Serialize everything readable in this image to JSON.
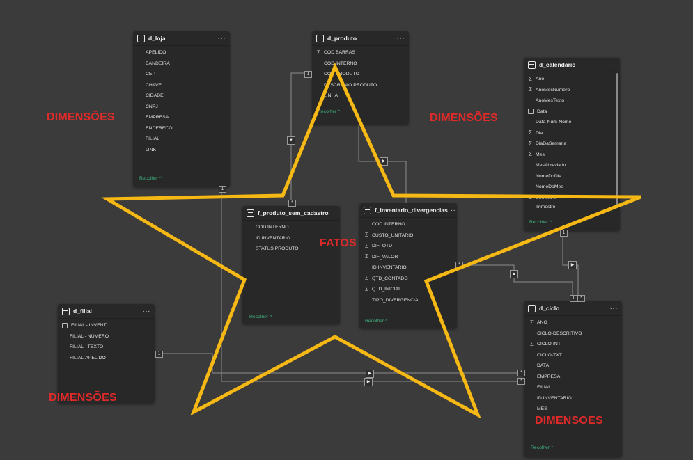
{
  "tables": {
    "d_loja": {
      "title": "d_loja",
      "menu": "···",
      "collapse": "Recolher ^",
      "fields": [
        "APELIDO",
        "BANDEIRA",
        "CEP",
        "CHAVE",
        "CIDADE",
        "CNPJ",
        "EMPRESA",
        "ENDERECO",
        "FILIAL",
        "LINK"
      ]
    },
    "d_produto": {
      "title": "d_produto",
      "menu": "···",
      "collapse": "Recolher ^",
      "fields": [
        {
          "name": "COD BARRAS",
          "icon": "sigma"
        },
        {
          "name": "COD INTERNO",
          "icon": ""
        },
        {
          "name": "COD PRODUTO",
          "icon": ""
        },
        {
          "name": "DESCRICAO PRODUTO",
          "icon": ""
        },
        {
          "name": "LINHA",
          "icon": ""
        }
      ]
    },
    "d_calendario": {
      "title": "d_calendario",
      "menu": "···",
      "collapse": "Recolher ^",
      "fields": [
        {
          "name": "Ano",
          "icon": "sigma"
        },
        {
          "name": "AnoMesNumero",
          "icon": "sigma"
        },
        {
          "name": "AnoMesTexto",
          "icon": ""
        },
        {
          "name": "Data",
          "icon": "calendar"
        },
        {
          "name": "Data-Num-Nome",
          "icon": ""
        },
        {
          "name": "Dia",
          "icon": "sigma"
        },
        {
          "name": "DiaDaSemana",
          "icon": "sigma"
        },
        {
          "name": "Mes",
          "icon": "sigma"
        },
        {
          "name": "MesAbreviado",
          "icon": ""
        },
        {
          "name": "NomeDoDia",
          "icon": ""
        },
        {
          "name": "NomeDoMes",
          "icon": ""
        },
        {
          "name": "Semestre",
          "icon": "sigma"
        },
        {
          "name": "Trimestre",
          "icon": ""
        }
      ]
    },
    "f_produto_sem_cadastro": {
      "title": "f_produto_sem_cadastro",
      "menu": "···",
      "collapse": "Recolher ^",
      "fields": [
        "COD INTERNO",
        "ID INVENTARIO",
        "STATUS PRODUTO"
      ]
    },
    "f_inventario_divergencias": {
      "title": "f_inventario_divergencias",
      "menu": "···",
      "collapse": "Recolher ^",
      "fields": [
        {
          "name": "COD INTERNO",
          "icon": ""
        },
        {
          "name": "CUSTO_UNITARIO",
          "icon": "sigma"
        },
        {
          "name": "DIF_QTD",
          "icon": "sigma"
        },
        {
          "name": "DIF_VALOR",
          "icon": "sigma"
        },
        {
          "name": "ID INVENTARIO",
          "icon": ""
        },
        {
          "name": "QTD_CONTADO",
          "icon": "sigma"
        },
        {
          "name": "QTD_INICIAL",
          "icon": "sigma"
        },
        {
          "name": "TIPO_DIVERGENCIA",
          "icon": ""
        }
      ]
    },
    "d_filial": {
      "title": "d_filial",
      "menu": "···",
      "fields": [
        {
          "name": "FILIAL - INVENT",
          "icon": "key"
        },
        {
          "name": "FILIAL - NUMERO",
          "icon": ""
        },
        {
          "name": "FILIAL - TEXTO",
          "icon": ""
        },
        {
          "name": "FILIAL-APELIDO",
          "icon": ""
        }
      ]
    },
    "d_ciclo": {
      "title": "d_ciclo",
      "menu": "···",
      "collapse": "Recolher ^",
      "fields": [
        {
          "name": "ANO",
          "icon": "sigma"
        },
        {
          "name": "CICLO-DESCRITIVO",
          "icon": ""
        },
        {
          "name": "CICLO-INT",
          "icon": "sigma"
        },
        {
          "name": "CICLO-TXT",
          "icon": ""
        },
        {
          "name": "DATA",
          "icon": ""
        },
        {
          "name": "EMPRESA",
          "icon": ""
        },
        {
          "name": "FILIAL",
          "icon": ""
        },
        {
          "name": "ID INVENTARIO",
          "icon": ""
        },
        {
          "name": "MES",
          "icon": ""
        }
      ]
    }
  },
  "annotations": {
    "dim_left": "DIMENSÕES",
    "dim_center": "DIMENSÕES",
    "dim_bottom_left": "DIMENSÕES",
    "dim_bottom_right": "DIMENSOES",
    "fatos": "FATOS"
  },
  "relationship_labels": {
    "one": "1",
    "many": "*"
  },
  "colors": {
    "canvas": "#3b3b3b",
    "card": "#282828",
    "star": "#f5b814",
    "annotation": "#e02a2a",
    "collapse_link": "#3fb37f",
    "line": "#8d8d8d"
  },
  "icons": {
    "sigma": "Σ",
    "calendar": "calendar-icon",
    "key": "key-icon",
    "arrow": "arrow-right-icon",
    "chevron": "chevron-down-icon"
  }
}
